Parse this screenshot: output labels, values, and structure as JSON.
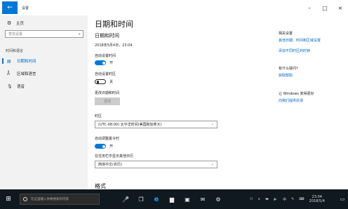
{
  "window": {
    "back_glyph": "←",
    "app_title": "设置",
    "minimize_glyph": "–",
    "maximize_glyph": "□",
    "close_glyph": "×"
  },
  "sidebar": {
    "home_label": "主页",
    "search_placeholder": "查找设置",
    "section_label": "时间和语言",
    "items": [
      {
        "label": "日期和时间",
        "icon": "calendar-clock-icon",
        "active": true
      },
      {
        "label": "区域和语言",
        "icon": "region-language-icon",
        "active": false
      },
      {
        "label": "语音",
        "icon": "microphone-icon",
        "active": false
      }
    ]
  },
  "main": {
    "page_title": "日期和时间",
    "section_title": "日期和时间",
    "current_datetime": "2018年5月4日，23:04",
    "auto_time_label": "自动设置时间",
    "auto_time_state": "开",
    "auto_timezone_label": "自动设置时区",
    "auto_timezone_state": "关",
    "change_datetime_label": "更改日期和时间",
    "change_button": "更改",
    "timezone_label": "时区",
    "timezone_value": "(UTC-08:00) 太平洋时间(美国和加拿大)",
    "dst_label": "自动调整夏令时",
    "dst_state": "开",
    "taskbar_calendar_label": "在任务栏中显示其他日历",
    "taskbar_calendar_value": "简体中文(农历)",
    "format_heading": "格式"
  },
  "right_pane": {
    "related_heading": "相关设置",
    "related_link_1": "其他日期、时间和区域设置",
    "related_link_2": "添加不同时区的时钟",
    "question_heading": "有什么疑问?",
    "question_link": "获取帮助",
    "improve_heading": "让 Windows 变得更好",
    "improve_link": "向我们提供反馈"
  },
  "taskbar": {
    "search_placeholder": "在这里输入你要搜索的内容",
    "clock_time": "23:04",
    "clock_date": "2018/5/4",
    "input_indicator": "中"
  },
  "colors": {
    "accent": "#0078d7",
    "link": "#0067c0",
    "sidebar_bg": "#f2f2f2",
    "taskbar_bg": "#101820"
  }
}
